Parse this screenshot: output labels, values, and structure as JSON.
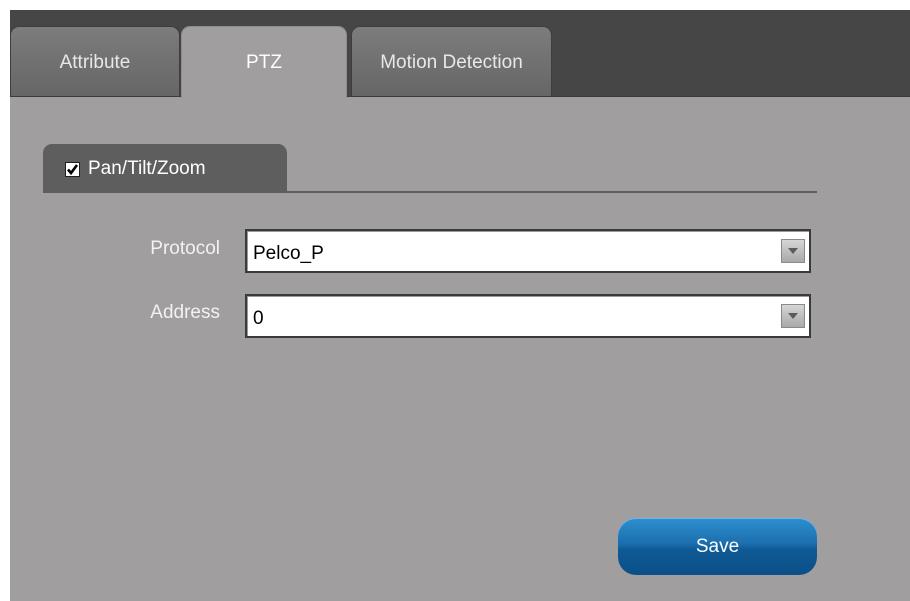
{
  "tabs": {
    "attribute": "Attribute",
    "ptz": "PTZ",
    "motion_detection": "Motion Detection",
    "active": "PTZ"
  },
  "ptz_section": {
    "title": "Pan/Tilt/Zoom",
    "enabled": true
  },
  "fields": {
    "protocol_label": "Protocol",
    "protocol_value": "Pelco_P",
    "address_label": "Address",
    "address_value": "0"
  },
  "actions": {
    "save_label": "Save"
  },
  "colors": {
    "panel_bg": "#a09e9e",
    "tab_bar_bg": "#464646",
    "save_button": "#1b6fae"
  },
  "icons": {
    "checkbox": "checkmark-icon",
    "dropdown": "chevron-down-icon"
  }
}
